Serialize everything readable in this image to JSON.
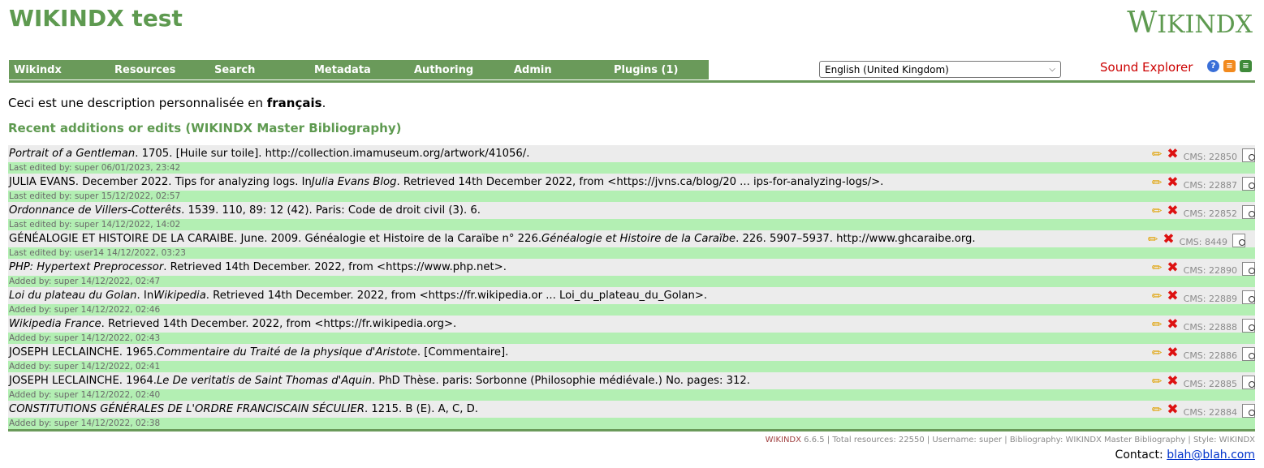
{
  "header": {
    "site_title": "WIKINDX test",
    "logo_text": "WIKINDX",
    "logo_first": "W",
    "logo_rest": "IKINDX"
  },
  "menu": {
    "items": [
      "Wikindx",
      "Resources",
      "Search",
      "Metadata",
      "Authoring",
      "Admin",
      "Plugins (1)"
    ]
  },
  "language_select": {
    "value": "English (United Kingdom)"
  },
  "sound_explorer": "Sound Explorer",
  "top_icons": [
    "help-icon",
    "rss-icon",
    "rss-alt-icon"
  ],
  "description": {
    "prefix": "Ceci est une description personnalisée en ",
    "bold": "français",
    "suffix": "."
  },
  "section_heading": "Recent additions or edits (WIKINDX Master Bibliography)",
  "resources": [
    {
      "parts": [
        {
          "t": "Portrait of a Gentleman",
          "i": true
        },
        {
          "t": ". 1705. [Huile sur toile]. http://collection.imamuseum.org/artwork/41056/.",
          "i": false
        }
      ],
      "meta": "Last edited by: super 06/01/2023, 23:42",
      "cms": "CMS: 22850"
    },
    {
      "parts": [
        {
          "t": "JULIA EVANS. December 2022. Tips for analyzing logs. In ",
          "i": false
        },
        {
          "t": "Julia Evans Blog",
          "i": true
        },
        {
          "t": ". Retrieved 14th December 2022, from <https://jvns.ca/blog/20 ... ips-for-analyzing-logs/>.",
          "i": false
        }
      ],
      "meta": "Last edited by: super 15/12/2022, 02:57",
      "cms": "CMS: 22887"
    },
    {
      "parts": [
        {
          "t": "Ordonnance de Villers-Cotterêts",
          "i": true
        },
        {
          "t": ". 1539. 110, 89: 12 (42). Paris: Code de droit civil (3). 6.",
          "i": false
        }
      ],
      "meta": "Last edited by: super 14/12/2022, 14:02",
      "cms": "CMS: 22852"
    },
    {
      "parts": [
        {
          "t": "GÉNÉALOGIE ET HISTOIRE DE LA CARAIBE. June. 2009. Généalogie et Histoire de la Caraïbe n° 226. ",
          "i": false
        },
        {
          "t": "Généalogie et Histoire de la Caraïbe",
          "i": true
        },
        {
          "t": ". 226. 5907–5937. http://www.ghcaraibe.org.",
          "i": false
        }
      ],
      "meta": "Last edited by: user14 14/12/2022, 03:23",
      "cms": "CMS: 8449"
    },
    {
      "parts": [
        {
          "t": "PHP: Hypertext Preprocessor",
          "i": true
        },
        {
          "t": ". Retrieved 14th December. 2022, from <https://www.php.net>.",
          "i": false
        }
      ],
      "meta": "Added by: super 14/12/2022, 02:47",
      "cms": "CMS: 22890"
    },
    {
      "parts": [
        {
          "t": "Loi du plateau du Golan",
          "i": true
        },
        {
          "t": ". In ",
          "i": false
        },
        {
          "t": "Wikipedia",
          "i": true
        },
        {
          "t": ". Retrieved 14th December. 2022, from <https://fr.wikipedia.or ... Loi_du_plateau_du_Golan>.",
          "i": false
        }
      ],
      "meta": "Added by: super 14/12/2022, 02:46",
      "cms": "CMS: 22889"
    },
    {
      "parts": [
        {
          "t": "Wikipedia France",
          "i": true
        },
        {
          "t": ". Retrieved 14th December. 2022, from <https://fr.wikipedia.org>.",
          "i": false
        }
      ],
      "meta": "Added by: super 14/12/2022, 02:43",
      "cms": "CMS: 22888"
    },
    {
      "parts": [
        {
          "t": "JOSEPH LECLAINCHE. 1965. ",
          "i": false
        },
        {
          "t": "Commentaire du Traité de la physique d'Aristote",
          "i": true
        },
        {
          "t": ". [Commentaire].",
          "i": false
        }
      ],
      "meta": "Added by: super 14/12/2022, 02:41",
      "cms": "CMS: 22886"
    },
    {
      "parts": [
        {
          "t": "JOSEPH LECLAINCHE. 1964. ",
          "i": false
        },
        {
          "t": "Le De veritatis de Saint Thomas d'Aquin",
          "i": true
        },
        {
          "t": ". PhD Thèse. paris: Sorbonne (Philosophie médiévale.) No. pages: 312.",
          "i": false
        }
      ],
      "meta": "Added by: super 14/12/2022, 02:40",
      "cms": "CMS: 22885"
    },
    {
      "parts": [
        {
          "t": "CONSTITUTIONS GÉNÉRALES DE L'ORDRE FRANCISCAIN SÉCULIER",
          "i": true
        },
        {
          "t": ". 1215. B (E). A, C, D.",
          "i": false
        }
      ],
      "meta": "Added by: super 14/12/2022, 02:38",
      "cms": "CMS: 22884"
    }
  ],
  "footer": {
    "brand": "WIKINDX",
    "stats": " 6.6.5 | Total resources: 22550 | Username: super | Bibliography: WIKINDX Master Bibliography | Style: WIKINDX",
    "contact_label": "Contact: ",
    "contact_email": "blah@blah.com"
  }
}
